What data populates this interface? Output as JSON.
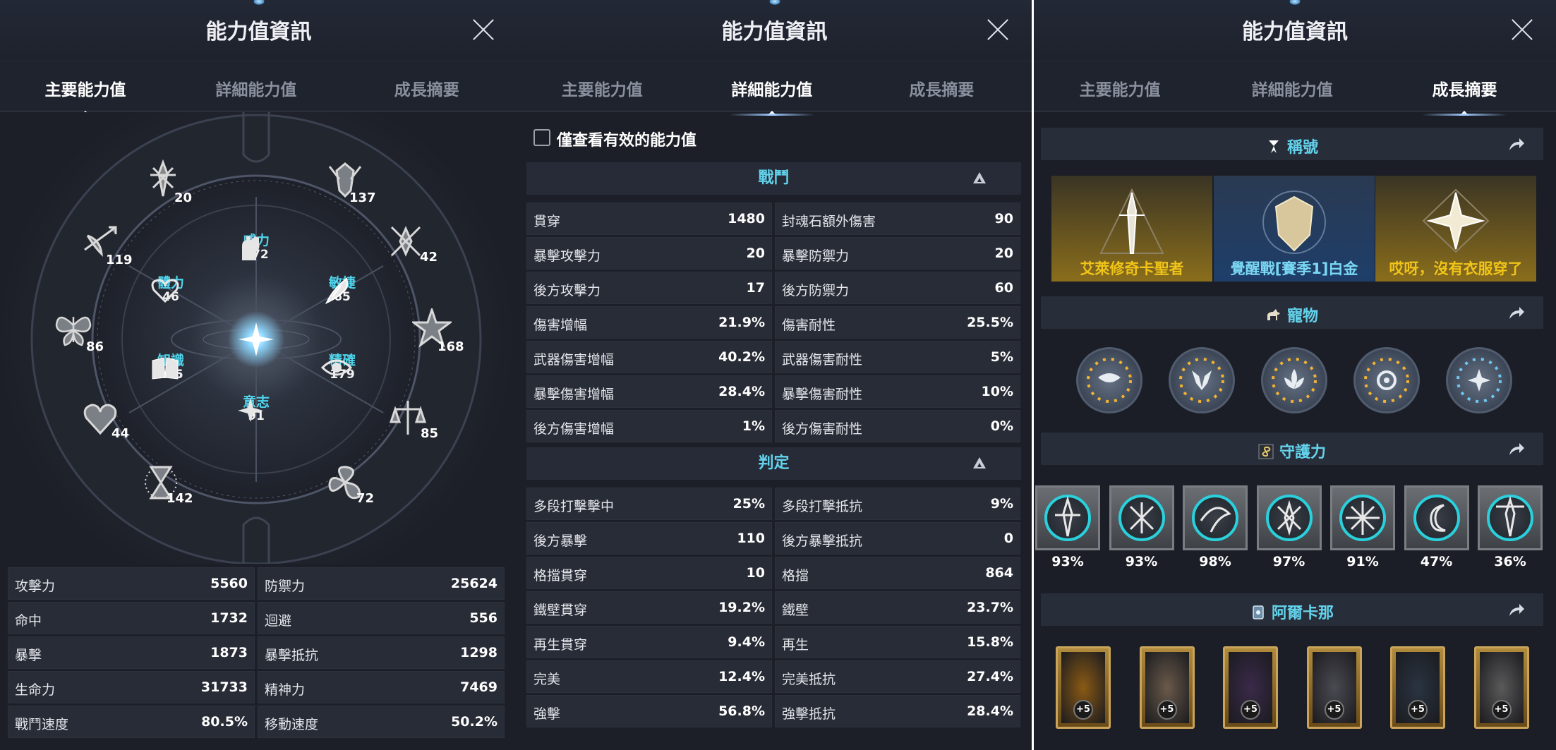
{
  "panels": [
    {
      "title": "能力值資訊",
      "tabs": [
        "主要能力值",
        "詳細能力值",
        "成長摘要"
      ],
      "active_tab": 0
    },
    {
      "title": "能力值資訊",
      "tabs": [
        "主要能力值",
        "詳細能力值",
        "成長摘要"
      ],
      "active_tab": 1
    },
    {
      "title": "能力值資訊",
      "tabs": [
        "主要能力值",
        "詳細能力值",
        "成長摘要"
      ],
      "active_tab": 2
    }
  ],
  "wheel": {
    "outer_values": [
      "20",
      "137",
      "42",
      "168",
      "85",
      "72",
      "142",
      "44",
      "86",
      "119"
    ],
    "inner": [
      {
        "name": "威力",
        "value": "172"
      },
      {
        "name": "敏捷",
        "value": "65"
      },
      {
        "name": "精確",
        "value": "179"
      },
      {
        "name": "意志",
        "value": "91"
      },
      {
        "name": "知識",
        "value": "105"
      },
      {
        "name": "體力",
        "value": "46"
      }
    ]
  },
  "main_stats": [
    [
      "攻擊力",
      "5560",
      "防禦力",
      "25624"
    ],
    [
      "命中",
      "1732",
      "迴避",
      "556"
    ],
    [
      "暴擊",
      "1873",
      "暴擊抵抗",
      "1298"
    ],
    [
      "生命力",
      "31733",
      "精神力",
      "7469"
    ],
    [
      "戰鬥速度",
      "80.5%",
      "移動速度",
      "50.2%"
    ]
  ],
  "detail": {
    "checkbox_label": "僅查看有效的能力值",
    "combat_title": "戰鬥",
    "combat": [
      [
        "貫穿",
        "1480",
        "封魂石額外傷害",
        "90"
      ],
      [
        "暴擊攻擊力",
        "20",
        "暴擊防禦力",
        "20"
      ],
      [
        "後方攻擊力",
        "17",
        "後方防禦力",
        "60"
      ],
      [
        "傷害增幅",
        "21.9%",
        "傷害耐性",
        "25.5%"
      ],
      [
        "武器傷害增幅",
        "40.2%",
        "武器傷害耐性",
        "5%"
      ],
      [
        "暴擊傷害增幅",
        "28.4%",
        "暴擊傷害耐性",
        "10%"
      ],
      [
        "後方傷害增幅",
        "1%",
        "後方傷害耐性",
        "0%"
      ]
    ],
    "judge_title": "判定",
    "judge": [
      [
        "多段打擊擊中",
        "25%",
        "多段打擊抵抗",
        "9%"
      ],
      [
        "後方暴擊",
        "110",
        "後方暴擊抵抗",
        "0"
      ],
      [
        "格擋貫穿",
        "10",
        "格擋",
        "864"
      ],
      [
        "鐵壁貫穿",
        "19.2%",
        "鐵壁",
        "23.7%"
      ],
      [
        "再生貫穿",
        "9.4%",
        "再生",
        "15.8%"
      ],
      [
        "完美",
        "12.4%",
        "完美抵抗",
        "27.4%"
      ],
      [
        "強擊",
        "56.8%",
        "強擊抵抗",
        "28.4%"
      ]
    ]
  },
  "growth": {
    "titles_header": "稱號",
    "titles": [
      "艾萊修奇卡聖者",
      "覺醒戰[賽季1]白金",
      "哎呀，沒有衣服穿了"
    ],
    "pets_header": "寵物",
    "guard_header": "守護力",
    "guard_percent": [
      "93%",
      "93%",
      "98%",
      "97%",
      "91%",
      "47%",
      "36%"
    ],
    "arcana_header": "阿爾卡那",
    "arcana_level": [
      "+5",
      "+5",
      "+5",
      "+5",
      "+5",
      "+5"
    ]
  },
  "colors": {
    "accent": "#63d3ec",
    "title_gold": "#f0c419",
    "title_blue": "#7ad8f4"
  }
}
